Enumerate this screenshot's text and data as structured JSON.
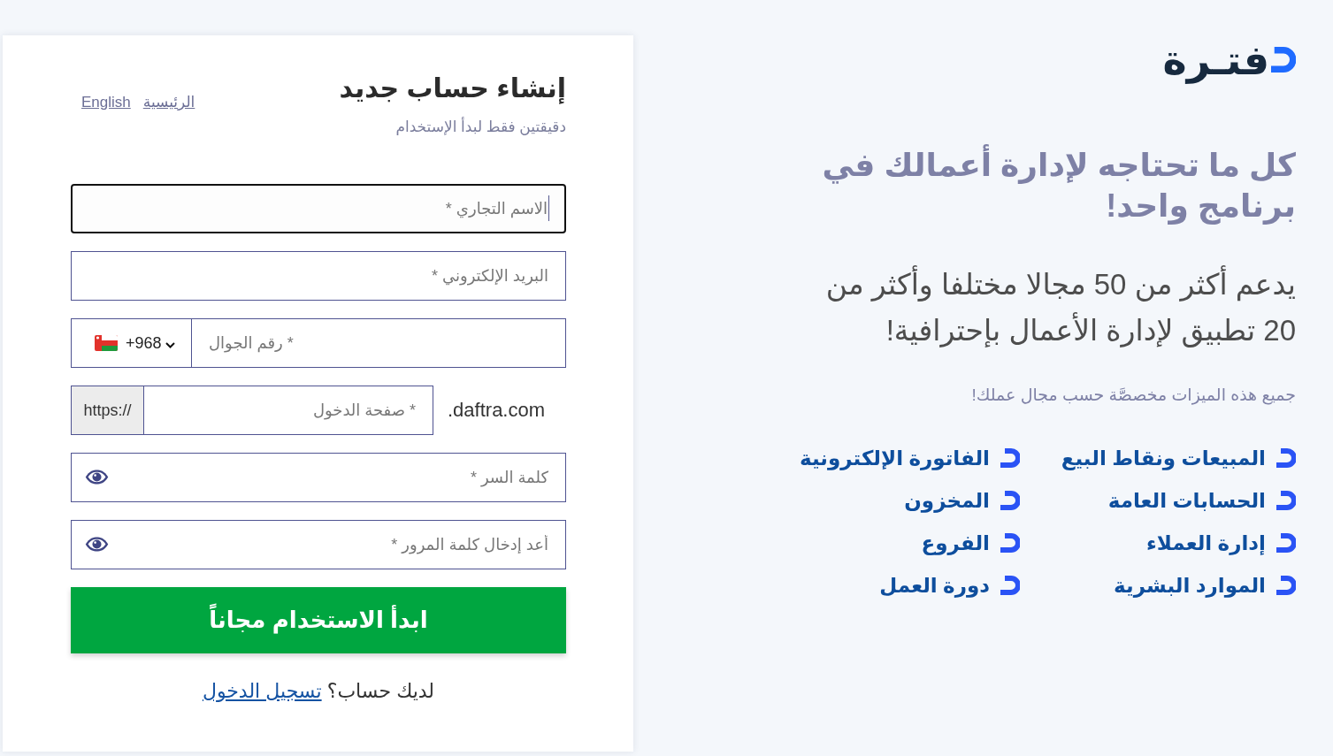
{
  "signup_card": {
    "title": "إنشاء حساب جديد",
    "subtitle": "دقيقتين فقط لبدأ الإستخدام",
    "nav_links": [
      "الرئيسية",
      "English"
    ],
    "fields": [
      {
        "kind": "text",
        "placeholder": "الاسم التجاري *",
        "focused": true
      },
      {
        "kind": "text",
        "placeholder": "البريد الإلكتروني *",
        "focused": false
      },
      {
        "kind": "phone",
        "country_code": "+968",
        "placeholder": "رقم الجوال *",
        "focused": false
      },
      {
        "kind": "subdomain",
        "prefix": "https://",
        "placeholder": "صفحة الدخول *",
        "suffix": ".daftra.com",
        "focused": false
      },
      {
        "kind": "password",
        "placeholder": "كلمة السر *",
        "focused": false
      },
      {
        "kind": "password",
        "placeholder": "أعد إدخال كلمة المرور *",
        "focused": false
      }
    ],
    "submit_button": "ابدأ الاستخدام مجاناً",
    "login_prompt": {
      "text": "لديك حساب؟",
      "link": "تسجيل الدخول"
    }
  },
  "promo": {
    "logo": "فتـرة",
    "headline": "كل ما تحتاجه لإدارة أعمالك في برنامج واحد!",
    "description": "يدعم أكثر من 50 مجالا مختلفا وأكثر من 20 تطبيق لإدارة الأعمال بإحترافية!",
    "note": "جميع هذه الميزات مخصصَّة حسب مجال عملك!",
    "features": [
      "المبيعات ونقاط البيع",
      "الفاتورة الإلكترونية",
      "الحسابات العامة",
      "المخزون",
      "إدارة العملاء",
      "الفروع",
      "الموارد البشرية",
      "دورة العمل"
    ]
  }
}
